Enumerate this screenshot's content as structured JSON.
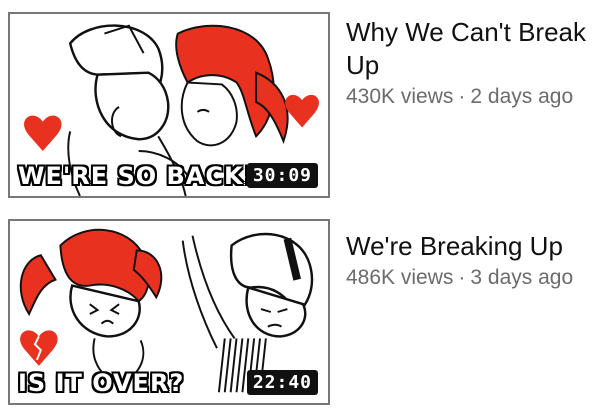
{
  "videos": [
    {
      "title": "Why We Can't Break Up",
      "views": "430K views",
      "separator": "·",
      "age": "2 days ago",
      "duration": "30:09",
      "thumb_caption": "WE'RE SO BACK!",
      "icons": [
        "heart-icon",
        "heart-icon"
      ]
    },
    {
      "title": "We're Breaking Up",
      "views": "486K views",
      "separator": "·",
      "age": "3 days ago",
      "duration": "22:40",
      "thumb_caption": "IS IT OVER?",
      "icons": [
        "broken-heart-icon"
      ]
    }
  ],
  "colors": {
    "accent_red": "#e8321f",
    "ink": "#111111",
    "meta_gray": "#6b6b6b"
  }
}
